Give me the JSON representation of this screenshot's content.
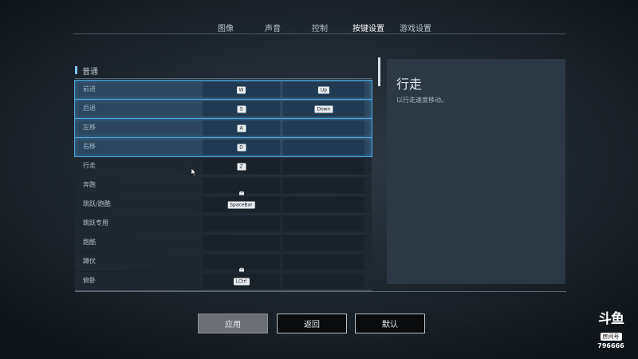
{
  "tabs": [
    {
      "label": "图像",
      "active": false
    },
    {
      "label": "声音",
      "active": false
    },
    {
      "label": "控制",
      "active": false
    },
    {
      "label": "按键设置",
      "active": true
    },
    {
      "label": "游戏设置",
      "active": false
    }
  ],
  "section": {
    "title": "普通"
  },
  "bindings": [
    {
      "action": "前进",
      "primary": "W",
      "secondary": "Up",
      "selected": true
    },
    {
      "action": "后退",
      "primary": "S",
      "secondary": "Down",
      "selected": true
    },
    {
      "action": "左移",
      "primary": "A",
      "secondary": "",
      "selected": true
    },
    {
      "action": "右移",
      "primary": "D",
      "secondary": "",
      "selected": true
    },
    {
      "action": "行走",
      "primary": "Z",
      "secondary": "",
      "selected": false
    },
    {
      "action": "奔跑",
      "primary_icon": "mouse-icon",
      "secondary": "",
      "selected": false
    },
    {
      "action": "跳跃/跑酷",
      "primary": "SpaceBar",
      "secondary": "",
      "selected": false
    },
    {
      "action": "跳跃专用",
      "primary": "",
      "secondary": "",
      "selected": false
    },
    {
      "action": "跑酷",
      "primary": "",
      "secondary": "",
      "selected": false
    },
    {
      "action": "蹲伏",
      "primary_icon": "mouse-icon",
      "secondary": "",
      "selected": false
    },
    {
      "action": "俯卧",
      "primary": "LCtrl",
      "secondary": "",
      "selected": false
    }
  ],
  "description": {
    "title": "行走",
    "text": "以行走速度移动。"
  },
  "buttons": {
    "apply": "应用",
    "back": "返回",
    "default": "默认"
  },
  "watermark": {
    "logo": "斗鱼",
    "room_label": "房间号",
    "room_number": "796666"
  },
  "colors": {
    "accent": "#4aa7dd",
    "selected_row": "#2d4760",
    "panel": "#2c3944"
  }
}
